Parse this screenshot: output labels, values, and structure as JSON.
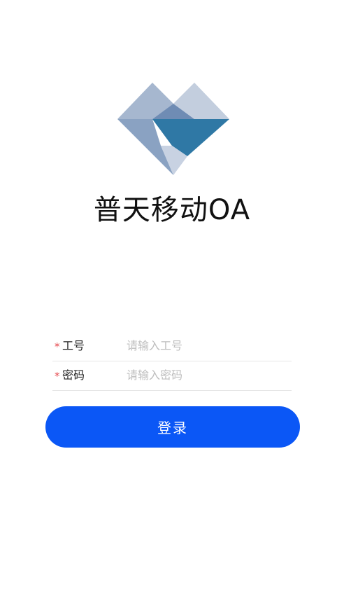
{
  "app": {
    "title": "普天移动OA"
  },
  "logo": {
    "icon": "heart-diamond-logo",
    "colors": [
      "#a6b7cf",
      "#8aa2c2",
      "#6f8cb4",
      "#2f78a5",
      "#c8d2e2"
    ]
  },
  "login_form": {
    "required_mark": "*",
    "employee_id": {
      "label": "工号",
      "value": "",
      "placeholder": "请输入工号"
    },
    "password": {
      "label": "密码",
      "value": "",
      "placeholder": "请输入密码"
    },
    "submit_label": "登录"
  },
  "theme": {
    "primary": "#0b57f6",
    "required": "#e5484d",
    "placeholder": "#bdbdbd"
  }
}
